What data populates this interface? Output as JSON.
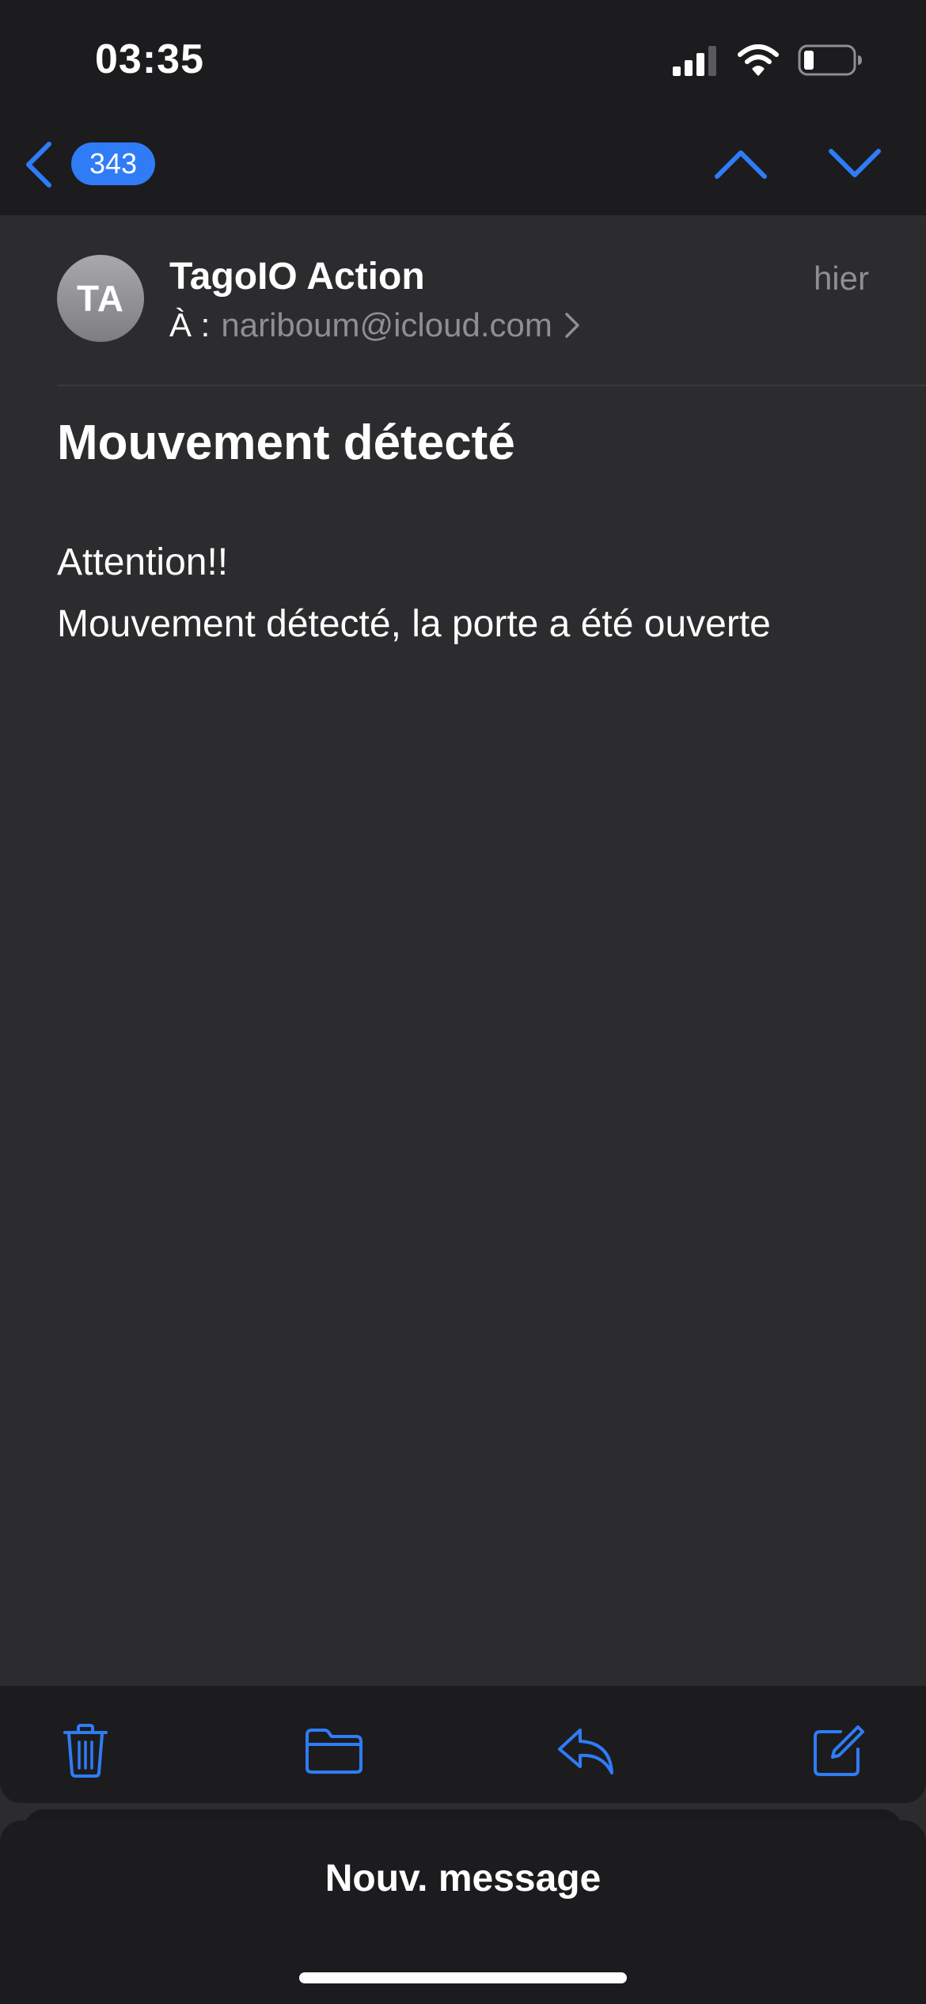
{
  "status_bar": {
    "time": "03:35",
    "icons": [
      "cellular-signal-icon",
      "wifi-icon",
      "battery-icon"
    ]
  },
  "nav": {
    "back_icon": "chevron-left-icon",
    "unread_count": "343",
    "prev_icon": "chevron-up-icon",
    "next_icon": "chevron-down-icon"
  },
  "message": {
    "avatar_initials": "TA",
    "sender": "TagoIO Action",
    "to_label": "À :",
    "to_address": "nariboum@icloud.com",
    "date": "hier",
    "subject": "Mouvement détecté",
    "body_lines": [
      "Attention!!",
      "Mouvement détecté, la porte a été ouverte"
    ]
  },
  "toolbar": {
    "items": [
      "trash-icon",
      "folder-icon",
      "reply-icon",
      "compose-icon"
    ]
  },
  "draft_sheet": {
    "title": "Nouv. message"
  },
  "colors": {
    "accent": "#2f7cf6",
    "background": "#2c2c2e",
    "bar_background": "#1c1c1e",
    "secondary_text": "#8e8e93"
  }
}
